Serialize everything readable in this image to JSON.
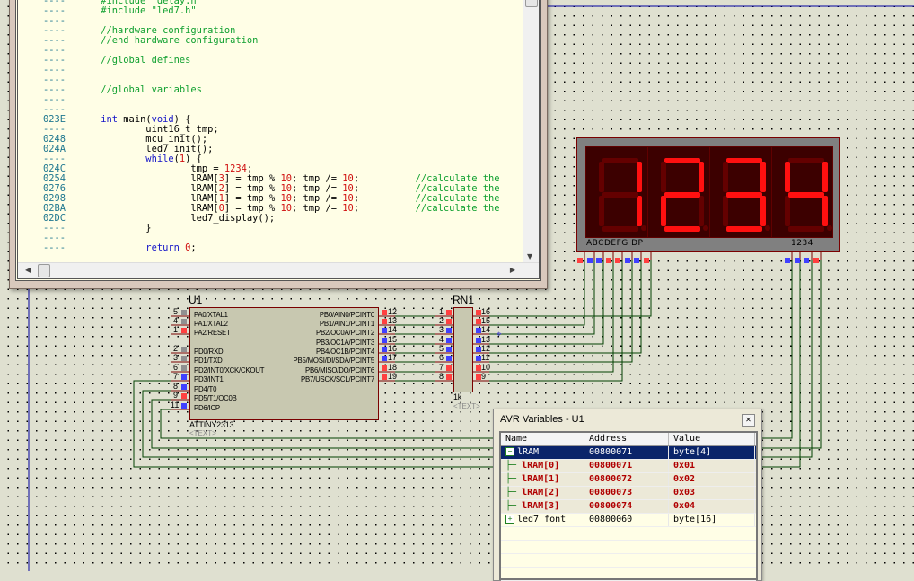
{
  "source_window": {
    "lines": [
      {
        "addr": "----",
        "parts": [
          {
            "t": "cm",
            "v": "#include \"delay.h\""
          }
        ]
      },
      {
        "addr": "----",
        "parts": [
          {
            "t": "cm",
            "v": "#include \"led7.h\""
          }
        ]
      },
      {
        "addr": "----",
        "parts": []
      },
      {
        "addr": "----",
        "parts": [
          {
            "t": "cm",
            "v": "//hardware configuration"
          }
        ]
      },
      {
        "addr": "----",
        "parts": [
          {
            "t": "cm",
            "v": "//end hardware configuration"
          }
        ]
      },
      {
        "addr": "----",
        "parts": []
      },
      {
        "addr": "----",
        "parts": [
          {
            "t": "cm",
            "v": "//global defines"
          }
        ]
      },
      {
        "addr": "----",
        "parts": []
      },
      {
        "addr": "----",
        "parts": []
      },
      {
        "addr": "----",
        "parts": [
          {
            "t": "cm",
            "v": "//global variables"
          }
        ]
      },
      {
        "addr": "----",
        "parts": []
      },
      {
        "addr": "----",
        "parts": []
      },
      {
        "addr": "023E",
        "parts": [
          {
            "t": "kw",
            "v": "int"
          },
          {
            "t": "tx",
            "v": " main("
          },
          {
            "t": "kw",
            "v": "void"
          },
          {
            "t": "tx",
            "v": ") {"
          }
        ]
      },
      {
        "addr": "----",
        "parts": [
          {
            "t": "tx",
            "v": "        uint16_t tmp;"
          }
        ]
      },
      {
        "addr": "0248",
        "parts": [
          {
            "t": "tx",
            "v": "        mcu_init();"
          }
        ]
      },
      {
        "addr": "024A",
        "parts": [
          {
            "t": "tx",
            "v": "        led7_init();"
          }
        ]
      },
      {
        "addr": "----",
        "parts": [
          {
            "t": "kw",
            "v": "        while"
          },
          {
            "t": "tx",
            "v": "("
          },
          {
            "t": "num",
            "v": "1"
          },
          {
            "t": "tx",
            "v": ") {"
          }
        ]
      },
      {
        "addr": "024C",
        "parts": [
          {
            "t": "tx",
            "v": "                tmp = "
          },
          {
            "t": "num",
            "v": "1234"
          },
          {
            "t": "tx",
            "v": ";"
          }
        ]
      },
      {
        "addr": "0254",
        "parts": [
          {
            "t": "tx",
            "v": "                lRAM["
          },
          {
            "t": "num",
            "v": "3"
          },
          {
            "t": "tx",
            "v": "] = tmp % "
          },
          {
            "t": "num",
            "v": "10"
          },
          {
            "t": "tx",
            "v": "; tmp /= "
          },
          {
            "t": "num",
            "v": "10"
          },
          {
            "t": "tx",
            "v": ";          "
          },
          {
            "t": "cm",
            "v": "//calculate the"
          }
        ]
      },
      {
        "addr": "0276",
        "parts": [
          {
            "t": "tx",
            "v": "                lRAM["
          },
          {
            "t": "num",
            "v": "2"
          },
          {
            "t": "tx",
            "v": "] = tmp % "
          },
          {
            "t": "num",
            "v": "10"
          },
          {
            "t": "tx",
            "v": "; tmp /= "
          },
          {
            "t": "num",
            "v": "10"
          },
          {
            "t": "tx",
            "v": ";          "
          },
          {
            "t": "cm",
            "v": "//calculate the"
          }
        ]
      },
      {
        "addr": "0298",
        "parts": [
          {
            "t": "tx",
            "v": "                lRAM["
          },
          {
            "t": "num",
            "v": "1"
          },
          {
            "t": "tx",
            "v": "] = tmp % "
          },
          {
            "t": "num",
            "v": "10"
          },
          {
            "t": "tx",
            "v": "; tmp /= "
          },
          {
            "t": "num",
            "v": "10"
          },
          {
            "t": "tx",
            "v": ";          "
          },
          {
            "t": "cm",
            "v": "//calculate the"
          }
        ]
      },
      {
        "addr": "02BA",
        "parts": [
          {
            "t": "tx",
            "v": "                lRAM["
          },
          {
            "t": "num",
            "v": "0"
          },
          {
            "t": "tx",
            "v": "] = tmp % "
          },
          {
            "t": "num",
            "v": "10"
          },
          {
            "t": "tx",
            "v": "; tmp /= "
          },
          {
            "t": "num",
            "v": "10"
          },
          {
            "t": "tx",
            "v": ";          "
          },
          {
            "t": "cm",
            "v": "//calculate the"
          }
        ]
      },
      {
        "addr": "02DC",
        "parts": [
          {
            "t": "tx",
            "v": "                led7_display();"
          }
        ]
      },
      {
        "addr": "----",
        "parts": [
          {
            "t": "tx",
            "v": "        }"
          }
        ]
      },
      {
        "addr": "----",
        "parts": []
      },
      {
        "addr": "----",
        "parts": [
          {
            "t": "kw",
            "v": "        return"
          },
          {
            "t": "tx",
            "v": " "
          },
          {
            "t": "num",
            "v": "0"
          },
          {
            "t": "tx",
            "v": ";"
          }
        ]
      }
    ]
  },
  "display": {
    "digits": [
      1,
      2,
      3,
      4
    ],
    "segment_label": "ABCDEFG  DP",
    "digit_label": "1234",
    "on_color": "#ff1010",
    "off_color": "#640000",
    "segment_pins": [
      "red",
      "blue",
      "blue",
      "red",
      "red",
      "blue",
      "blue",
      "red"
    ],
    "digit_pins": [
      "blue",
      "blue",
      "blue",
      "red"
    ]
  },
  "u1": {
    "ref": "U1",
    "part": "ATTINY2313",
    "text": "<TEXT>",
    "left_pins": [
      {
        "num": "5",
        "name": "PA0/XTAL1",
        "state": "gray"
      },
      {
        "num": "4",
        "name": "PA1/XTAL2",
        "state": "gray"
      },
      {
        "num": "1",
        "name": "PA2/RESET",
        "state": "red"
      },
      {
        "num": "2",
        "name": "PD0/RXD",
        "state": "gray"
      },
      {
        "num": "3",
        "name": "PD1/TXD",
        "state": "gray"
      },
      {
        "num": "6",
        "name": "PD2/INT0/XCK/CKOUT",
        "state": "gray"
      },
      {
        "num": "7",
        "name": "PD3/INT1",
        "state": "blue"
      },
      {
        "num": "8",
        "name": "PD4/T0",
        "state": "blue"
      },
      {
        "num": "9",
        "name": "PD5/T1/OC0B",
        "state": "red"
      },
      {
        "num": "11",
        "name": "PD6/ICP",
        "state": "blue"
      }
    ],
    "right_pins": [
      {
        "num": "12",
        "name": "PB0/AIN0/PCINT0",
        "state": "red"
      },
      {
        "num": "13",
        "name": "PB1/AIN1/PCINT1",
        "state": "red"
      },
      {
        "num": "14",
        "name": "PB2/OC0A/PCINT2",
        "state": "blue"
      },
      {
        "num": "15",
        "name": "PB3/OC1A/PCINT3",
        "state": "blue"
      },
      {
        "num": "16",
        "name": "PB4/OC1B/PCINT4",
        "state": "blue"
      },
      {
        "num": "17",
        "name": "PB5/MOSI/DI/SDA/PCINT5",
        "state": "blue"
      },
      {
        "num": "18",
        "name": "PB6/MISO/DO/PCINT6",
        "state": "red"
      },
      {
        "num": "19",
        "name": "PB7/USCK/SCL/PCINT7",
        "state": "red"
      }
    ]
  },
  "rn1": {
    "ref": "RN1",
    "value": "1k",
    "text": "<TEXT>",
    "left_pins": [
      {
        "num": "1",
        "state": "red"
      },
      {
        "num": "2",
        "state": "red"
      },
      {
        "num": "3",
        "state": "blue"
      },
      {
        "num": "4",
        "state": "blue"
      },
      {
        "num": "5",
        "state": "blue"
      },
      {
        "num": "6",
        "state": "blue"
      },
      {
        "num": "7",
        "state": "red"
      },
      {
        "num": "8",
        "state": "red"
      }
    ],
    "right_pins": [
      {
        "num": "16",
        "state": "red"
      },
      {
        "num": "15",
        "state": "red"
      },
      {
        "num": "14",
        "state": "blue"
      },
      {
        "num": "13",
        "state": "blue"
      },
      {
        "num": "12",
        "state": "blue"
      },
      {
        "num": "11",
        "state": "blue"
      },
      {
        "num": "10",
        "state": "red"
      },
      {
        "num": "9",
        "state": "red"
      }
    ]
  },
  "avr_variables": {
    "title": "AVR Variables - U1",
    "columns": [
      "Name",
      "Address",
      "Value"
    ],
    "rows": [
      {
        "name": "lRAM",
        "address": "00800071",
        "value": "byte[4]",
        "toggle": "−",
        "kind": "sel"
      },
      {
        "name": "lRAM[0]",
        "address": "00800071",
        "value": "0x01",
        "kind": "child"
      },
      {
        "name": "lRAM[1]",
        "address": "00800072",
        "value": "0x02",
        "kind": "child"
      },
      {
        "name": "lRAM[2]",
        "address": "00800073",
        "value": "0x03",
        "kind": "child"
      },
      {
        "name": "lRAM[3]",
        "address": "00800074",
        "value": "0x04",
        "kind": "child"
      },
      {
        "name": "led7_font",
        "address": "00800060",
        "value": "byte[16]",
        "toggle": "+",
        "kind": "normal"
      }
    ]
  },
  "colors": {
    "pin_red": "#ff4040",
    "pin_blue": "#4040ff",
    "pin_gray": "#909090",
    "wire": "#004000",
    "pin_line": "#7a0000"
  }
}
